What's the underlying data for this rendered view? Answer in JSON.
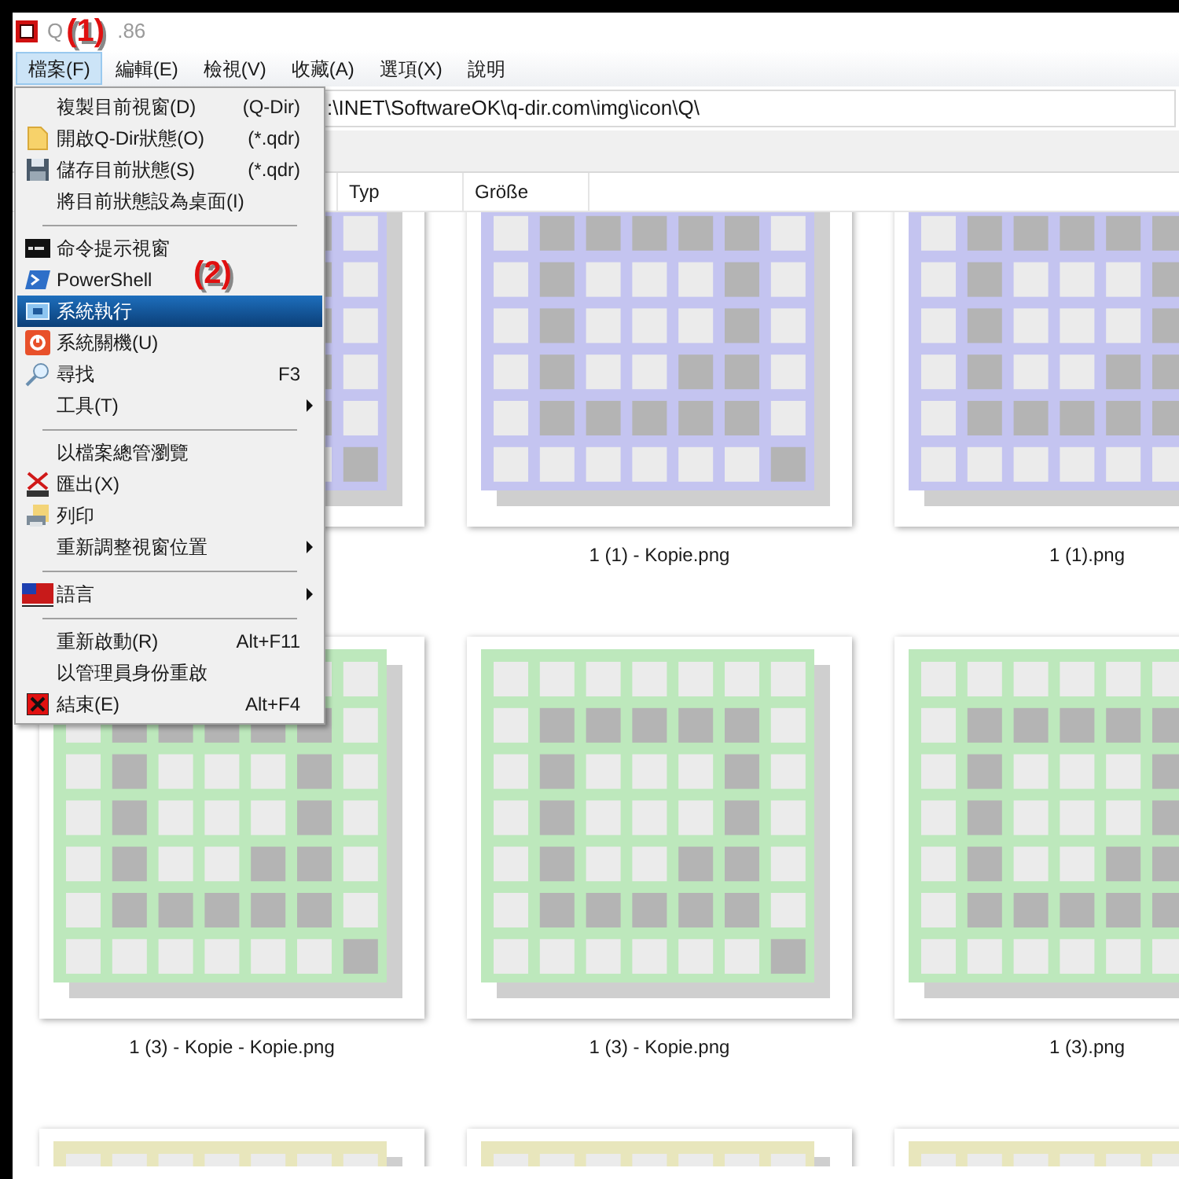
{
  "window": {
    "title_start": "Q",
    "title_end": ".86"
  },
  "annotations": [
    {
      "label": "(1)"
    },
    {
      "label": "(2)"
    }
  ],
  "menubar": [
    {
      "label": "檔案(F)",
      "selected": true
    },
    {
      "label": "編輯(E)",
      "selected": false
    },
    {
      "label": "檢視(V)",
      "selected": false
    },
    {
      "label": "收藏(A)",
      "selected": false
    },
    {
      "label": "選項(X)",
      "selected": false
    },
    {
      "label": "說明",
      "selected": false
    }
  ],
  "address_bar": {
    "value": ":\\INET\\SoftwareOK\\q-dir.com\\img\\icon\\Q\\"
  },
  "columns": [
    "Typ",
    "Größe"
  ],
  "menu": [
    {
      "kind": "item",
      "label": "複製目前視窗(D)",
      "shortcut": "(Q-Dir)",
      "selected": false,
      "submenu": false
    },
    {
      "kind": "item",
      "label": "開啟Q-Dir狀態(O)",
      "shortcut": "(*.qdr)",
      "selected": false,
      "submenu": false
    },
    {
      "kind": "item",
      "label": "儲存目前狀態(S)",
      "shortcut": "(*.qdr)",
      "selected": false,
      "submenu": false
    },
    {
      "kind": "item",
      "label": "將目前狀態設為桌面(I)",
      "selected": false,
      "submenu": false
    },
    {
      "kind": "separator"
    },
    {
      "kind": "item",
      "label": "命令提示視窗",
      "selected": false,
      "submenu": false
    },
    {
      "kind": "item",
      "label": "PowerShell",
      "selected": false,
      "submenu": false
    },
    {
      "kind": "item",
      "label": "系統執行",
      "selected": true,
      "submenu": false
    },
    {
      "kind": "item",
      "label": "系統關機(U)",
      "selected": false,
      "submenu": false
    },
    {
      "kind": "item",
      "label": "尋找",
      "shortcut": "F3",
      "selected": false,
      "submenu": false
    },
    {
      "kind": "item",
      "label": "工具(T)",
      "selected": false,
      "submenu": true
    },
    {
      "kind": "separator"
    },
    {
      "kind": "item",
      "label": "以檔案總管瀏覽",
      "selected": false,
      "submenu": false
    },
    {
      "kind": "item",
      "label": "匯出(X)",
      "selected": false,
      "submenu": false
    },
    {
      "kind": "item",
      "label": "列印",
      "selected": false,
      "submenu": false
    },
    {
      "kind": "item",
      "label": "重新調整視窗位置",
      "selected": false,
      "submenu": true
    },
    {
      "kind": "separator"
    },
    {
      "kind": "item",
      "label": "語言",
      "selected": false,
      "submenu": true
    },
    {
      "kind": "separator"
    },
    {
      "kind": "item",
      "label": "重新啟動(R)",
      "shortcut": "Alt+F11",
      "selected": false,
      "submenu": false
    },
    {
      "kind": "item",
      "label": "以管理員身份重啟",
      "selected": false,
      "submenu": false
    },
    {
      "kind": "item",
      "label": "結束(E)",
      "shortcut": "Alt+F4",
      "selected": false,
      "submenu": false
    }
  ],
  "thumbnails": [
    {
      "color": "#c4c4f0"
    },
    {
      "label": "1 (1) - Kopie.png",
      "color": "#c4c4f0"
    },
    {
      "label": "1 (1).png",
      "color": "#c4c4f0"
    },
    {
      "label": "1 (3) - Kopie - Kopie.png",
      "color": "#bde8bc"
    },
    {
      "label": "1 (3) - Kopie.png",
      "color": "#bde8bc"
    },
    {
      "label": "1 (3).png",
      "color": "#bde8bc"
    },
    {
      "color": "#e8e6bc"
    },
    {
      "color": "#e8e6bc"
    },
    {
      "color": "#e8e6bc"
    }
  ]
}
